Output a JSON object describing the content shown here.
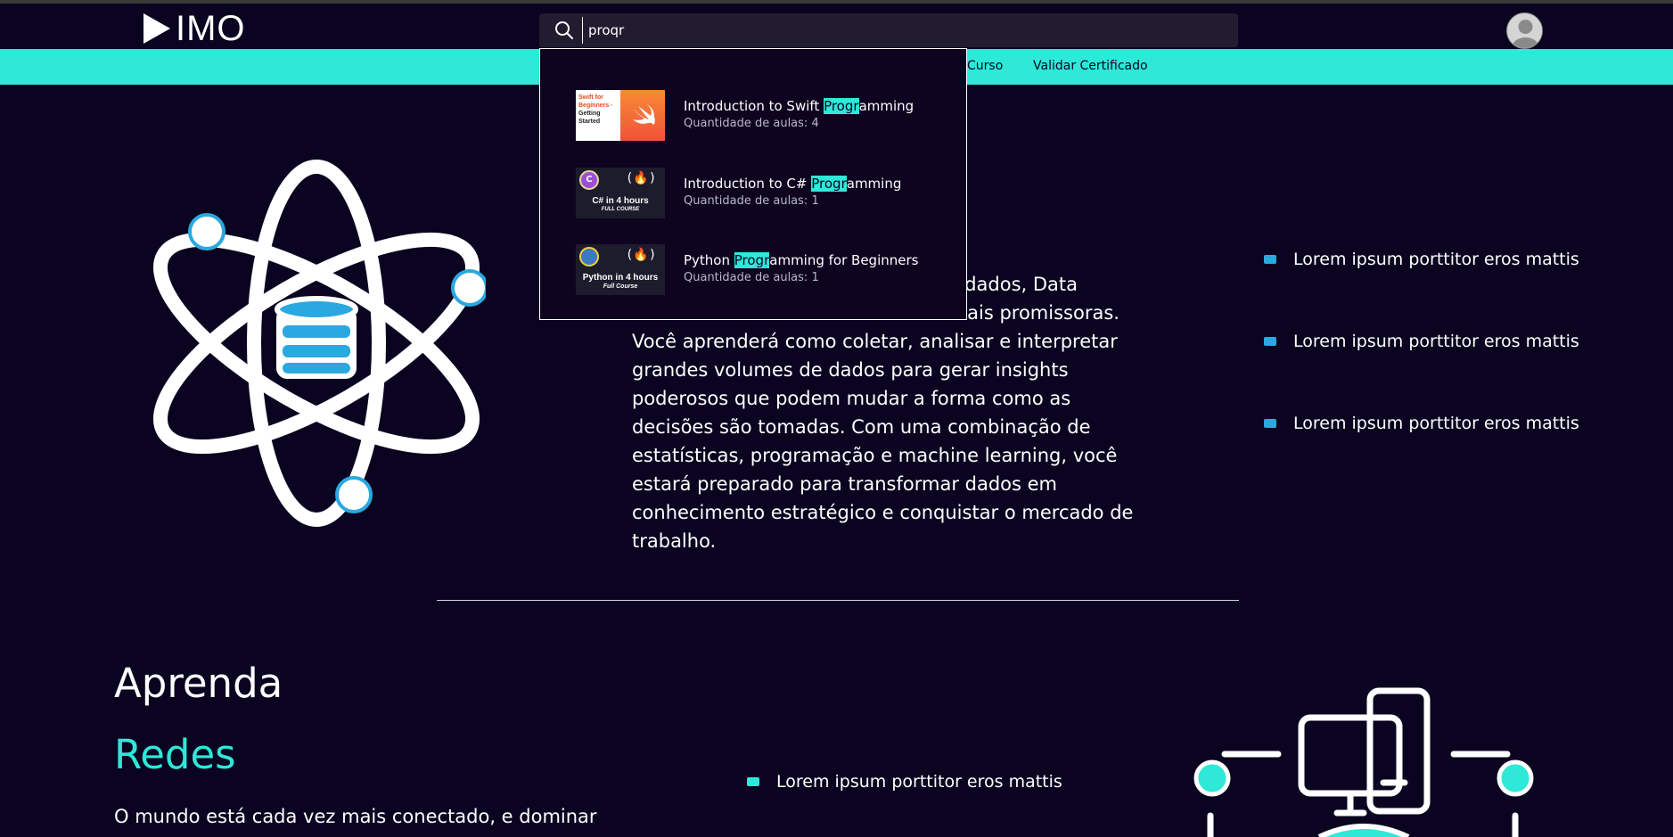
{
  "header": {
    "logo_text": "IMO",
    "search": {
      "value": "proqr",
      "icon": "search-icon"
    },
    "avatar_icon": "user-avatar-icon"
  },
  "nav": {
    "links": [
      "Curso",
      "Validar Certificado"
    ]
  },
  "dropdown": {
    "results": [
      {
        "title_before": "Introduction to Swift ",
        "title_highlight": "Progr",
        "title_after": "amming",
        "meta": "Quantidade de aulas: 4",
        "thumb_lines": [
          "Swift for",
          "Beginners -",
          "Getting",
          "Started"
        ]
      },
      {
        "title_before": "Introduction to C# ",
        "title_highlight": "Progr",
        "title_after": "amming",
        "meta": "Quantidade de aulas: 1",
        "thumb_lines": [
          "C# in 4 hours",
          "FULL COURSE"
        ]
      },
      {
        "title_before": "Python ",
        "title_highlight": "Progr",
        "title_after": "amming for Beginners",
        "meta": "Quantidade de aulas: 1",
        "thumb_lines": [
          "Python in 4 hours",
          "Full Course"
        ]
      }
    ]
  },
  "section1": {
    "paragraph_fragment": "lo por dados, Data",
    "paragraph": "Science se tornou uma das áreas mais promissoras. Você aprenderá como coletar, analisar e interpretar grandes volumes de dados para gerar insights poderosos que podem mudar a forma como as decisões são tomadas. Com uma combinação de estatísticas, programação e machine learning, você estará preparado para transformar dados em conhecimento estratégico e conquistar o mercado de trabalho.",
    "bullets": [
      "Lorem ipsum porttitor eros mattis",
      "Lorem ipsum porttitor eros mattis",
      "Lorem ipsum porttitor eros mattis"
    ],
    "illustration_icon": "atom-database-icon"
  },
  "section2": {
    "heading": "Aprenda",
    "subheading": "Redes",
    "paragraph": "O mundo está cada vez mais conectado, e dominar",
    "bullets": [
      "Lorem ipsum porttitor eros mattis"
    ],
    "illustration_icon": "computer-network-icon"
  },
  "colors": {
    "background": "#0a0420",
    "accent": "#2ee8d8",
    "bullet_blue": "#2aa8e0"
  }
}
